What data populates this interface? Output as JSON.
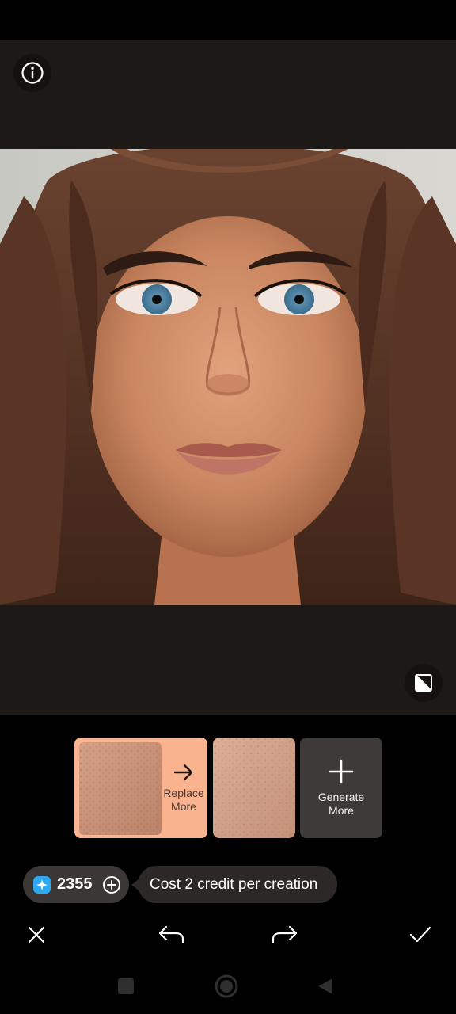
{
  "editor": {
    "info_icon": "info-icon",
    "compare_icon": "compare-icon",
    "photo_subject": "portrait"
  },
  "variants": {
    "replace_label": "Replace\nMore",
    "generate_label": "Generate\nMore"
  },
  "credits": {
    "count": "2355",
    "cost_message": "Cost 2 credit per creation"
  },
  "actions": {
    "cancel_icon": "close-icon",
    "undo_icon": "undo-icon",
    "redo_icon": "redo-icon",
    "confirm_icon": "check-icon"
  },
  "colors": {
    "accent": "#f9b48f",
    "panel": "#1d1917",
    "credit_blue": "#2ea8f0"
  }
}
